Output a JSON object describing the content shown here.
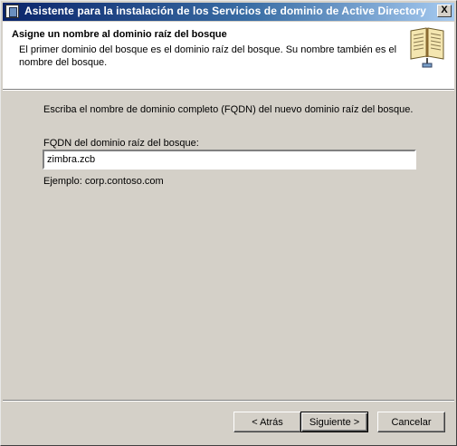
{
  "window": {
    "title": "Asistente para la instalación de los Servicios de dominio de Active Directory",
    "close_glyph": "X"
  },
  "header": {
    "title": "Asigne un nombre al dominio raíz del bosque",
    "description": "El primer dominio del bosque es el dominio raíz del bosque. Su nombre también es el nombre del bosque."
  },
  "main": {
    "instruction": "Escriba el nombre de dominio completo (FQDN) del nuevo dominio raíz del bosque.",
    "fqdn_label": "FQDN del dominio raíz del bosque:",
    "fqdn_value": "zimbra.zcb",
    "example": "Ejemplo: corp.contoso.com"
  },
  "footer": {
    "back_label": "< Atrás",
    "next_label": "Siguiente >",
    "cancel_label": "Cancelar"
  },
  "icons": {
    "window": "wizard-icon",
    "header": "book-icon",
    "close": "close-icon"
  },
  "colors": {
    "titlebar_start": "#0a246a",
    "titlebar_end": "#a6caf0",
    "dialog_bg": "#d4d0c8",
    "header_bg": "#ffffff"
  }
}
